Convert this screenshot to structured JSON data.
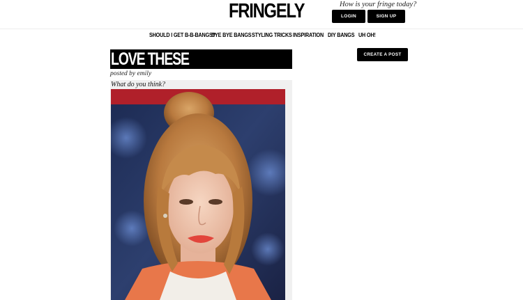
{
  "header": {
    "logo": "FRINGELY",
    "tagline": "How is your fringe today?",
    "login_label": "LOGIN",
    "signup_label": "SIGN UP"
  },
  "nav": {
    "items": [
      {
        "label": "SHOULD I GET B-B-BANGS?"
      },
      {
        "label": "BYE BYE BANGS"
      },
      {
        "label": "STYLING TRICKS"
      },
      {
        "label": "INSPIRATION"
      },
      {
        "label": "DIY BANGS"
      },
      {
        "label": "UH OH!"
      }
    ]
  },
  "post": {
    "title": "LOVE THESE",
    "posted_by": "posted by emily",
    "text": "What do you think?"
  },
  "sidebar": {
    "create_label": "CREATE A POST"
  },
  "colors": {
    "button_bg": "#000000",
    "button_text": "#ffffff",
    "post_bg": "#f0f0f0"
  }
}
